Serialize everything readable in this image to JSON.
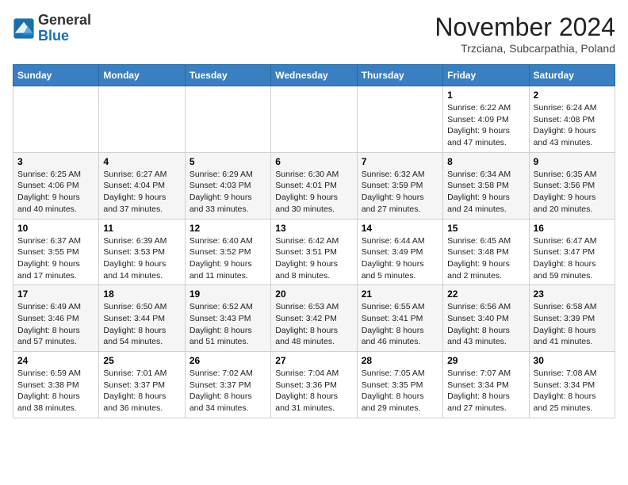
{
  "logo": {
    "general": "General",
    "blue": "Blue"
  },
  "header": {
    "month": "November 2024",
    "location": "Trzciana, Subcarpathia, Poland"
  },
  "weekdays": [
    "Sunday",
    "Monday",
    "Tuesday",
    "Wednesday",
    "Thursday",
    "Friday",
    "Saturday"
  ],
  "weeks": [
    [
      {
        "day": "",
        "info": ""
      },
      {
        "day": "",
        "info": ""
      },
      {
        "day": "",
        "info": ""
      },
      {
        "day": "",
        "info": ""
      },
      {
        "day": "",
        "info": ""
      },
      {
        "day": "1",
        "info": "Sunrise: 6:22 AM\nSunset: 4:09 PM\nDaylight: 9 hours\nand 47 minutes."
      },
      {
        "day": "2",
        "info": "Sunrise: 6:24 AM\nSunset: 4:08 PM\nDaylight: 9 hours\nand 43 minutes."
      }
    ],
    [
      {
        "day": "3",
        "info": "Sunrise: 6:25 AM\nSunset: 4:06 PM\nDaylight: 9 hours\nand 40 minutes."
      },
      {
        "day": "4",
        "info": "Sunrise: 6:27 AM\nSunset: 4:04 PM\nDaylight: 9 hours\nand 37 minutes."
      },
      {
        "day": "5",
        "info": "Sunrise: 6:29 AM\nSunset: 4:03 PM\nDaylight: 9 hours\nand 33 minutes."
      },
      {
        "day": "6",
        "info": "Sunrise: 6:30 AM\nSunset: 4:01 PM\nDaylight: 9 hours\nand 30 minutes."
      },
      {
        "day": "7",
        "info": "Sunrise: 6:32 AM\nSunset: 3:59 PM\nDaylight: 9 hours\nand 27 minutes."
      },
      {
        "day": "8",
        "info": "Sunrise: 6:34 AM\nSunset: 3:58 PM\nDaylight: 9 hours\nand 24 minutes."
      },
      {
        "day": "9",
        "info": "Sunrise: 6:35 AM\nSunset: 3:56 PM\nDaylight: 9 hours\nand 20 minutes."
      }
    ],
    [
      {
        "day": "10",
        "info": "Sunrise: 6:37 AM\nSunset: 3:55 PM\nDaylight: 9 hours\nand 17 minutes."
      },
      {
        "day": "11",
        "info": "Sunrise: 6:39 AM\nSunset: 3:53 PM\nDaylight: 9 hours\nand 14 minutes."
      },
      {
        "day": "12",
        "info": "Sunrise: 6:40 AM\nSunset: 3:52 PM\nDaylight: 9 hours\nand 11 minutes."
      },
      {
        "day": "13",
        "info": "Sunrise: 6:42 AM\nSunset: 3:51 PM\nDaylight: 9 hours\nand 8 minutes."
      },
      {
        "day": "14",
        "info": "Sunrise: 6:44 AM\nSunset: 3:49 PM\nDaylight: 9 hours\nand 5 minutes."
      },
      {
        "day": "15",
        "info": "Sunrise: 6:45 AM\nSunset: 3:48 PM\nDaylight: 9 hours\nand 2 minutes."
      },
      {
        "day": "16",
        "info": "Sunrise: 6:47 AM\nSunset: 3:47 PM\nDaylight: 8 hours\nand 59 minutes."
      }
    ],
    [
      {
        "day": "17",
        "info": "Sunrise: 6:49 AM\nSunset: 3:46 PM\nDaylight: 8 hours\nand 57 minutes."
      },
      {
        "day": "18",
        "info": "Sunrise: 6:50 AM\nSunset: 3:44 PM\nDaylight: 8 hours\nand 54 minutes."
      },
      {
        "day": "19",
        "info": "Sunrise: 6:52 AM\nSunset: 3:43 PM\nDaylight: 8 hours\nand 51 minutes."
      },
      {
        "day": "20",
        "info": "Sunrise: 6:53 AM\nSunset: 3:42 PM\nDaylight: 8 hours\nand 48 minutes."
      },
      {
        "day": "21",
        "info": "Sunrise: 6:55 AM\nSunset: 3:41 PM\nDaylight: 8 hours\nand 46 minutes."
      },
      {
        "day": "22",
        "info": "Sunrise: 6:56 AM\nSunset: 3:40 PM\nDaylight: 8 hours\nand 43 minutes."
      },
      {
        "day": "23",
        "info": "Sunrise: 6:58 AM\nSunset: 3:39 PM\nDaylight: 8 hours\nand 41 minutes."
      }
    ],
    [
      {
        "day": "24",
        "info": "Sunrise: 6:59 AM\nSunset: 3:38 PM\nDaylight: 8 hours\nand 38 minutes."
      },
      {
        "day": "25",
        "info": "Sunrise: 7:01 AM\nSunset: 3:37 PM\nDaylight: 8 hours\nand 36 minutes."
      },
      {
        "day": "26",
        "info": "Sunrise: 7:02 AM\nSunset: 3:37 PM\nDaylight: 8 hours\nand 34 minutes."
      },
      {
        "day": "27",
        "info": "Sunrise: 7:04 AM\nSunset: 3:36 PM\nDaylight: 8 hours\nand 31 minutes."
      },
      {
        "day": "28",
        "info": "Sunrise: 7:05 AM\nSunset: 3:35 PM\nDaylight: 8 hours\nand 29 minutes."
      },
      {
        "day": "29",
        "info": "Sunrise: 7:07 AM\nSunset: 3:34 PM\nDaylight: 8 hours\nand 27 minutes."
      },
      {
        "day": "30",
        "info": "Sunrise: 7:08 AM\nSunset: 3:34 PM\nDaylight: 8 hours\nand 25 minutes."
      }
    ]
  ]
}
